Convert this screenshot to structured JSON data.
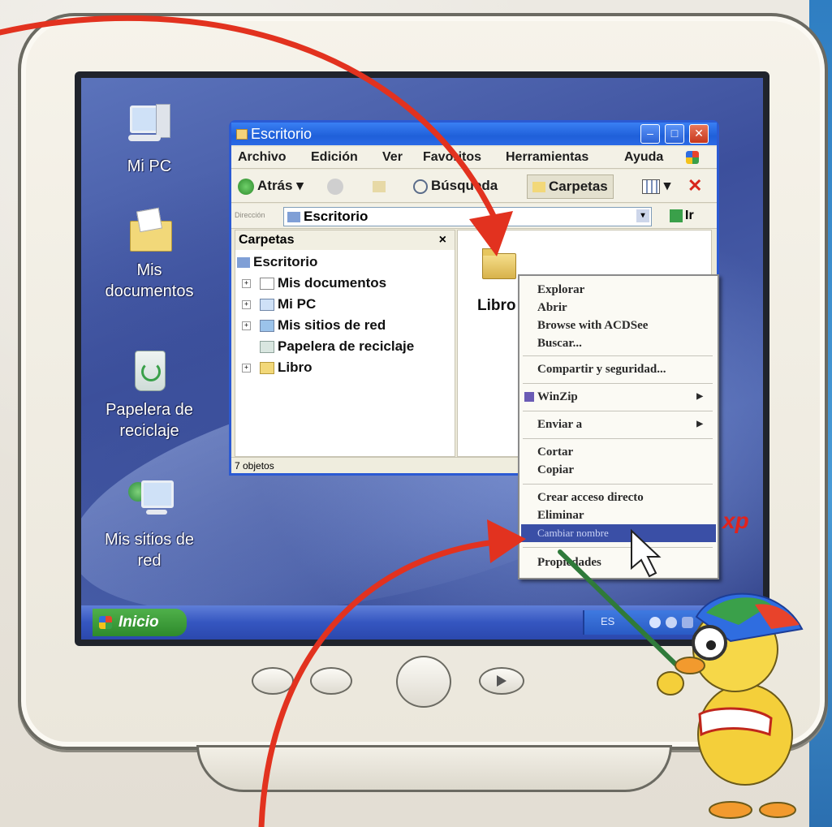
{
  "desktop": {
    "icons": [
      {
        "label": "Mi PC",
        "name": "my-computer-icon"
      },
      {
        "label": "Mis documentos",
        "name": "my-documents-icon"
      },
      {
        "label": "Papelera de reciclaje",
        "name": "recycle-bin-icon"
      },
      {
        "label": "Mis sitios de red",
        "name": "network-places-icon"
      }
    ]
  },
  "taskbar": {
    "start_label": "Inicio",
    "tray_lang": "ES"
  },
  "window": {
    "title": "Escritorio",
    "menu": [
      "Archivo",
      "Edición",
      "Ver",
      "Favoritos",
      "Herramientas",
      "Ayuda"
    ],
    "toolbar": {
      "back_label": "Atrás",
      "search_label": "Búsqueda",
      "folders_label": "Carpetas"
    },
    "address": {
      "label": "Dirección",
      "value": "Escritorio",
      "go_label": "Ir"
    },
    "folders_pane": {
      "title": "Carpetas",
      "items": [
        "Escritorio",
        "Mis documentos",
        "Mi PC",
        "Mis sitios de red",
        "Papelera de reciclaje",
        "Libro"
      ]
    },
    "content": {
      "folder_label": "Libro"
    },
    "status": "7 objetos"
  },
  "context_menu": {
    "items": [
      "Explorar",
      "Abrir",
      "Browse with ACDSee",
      "Buscar...",
      "Compartir y seguridad...",
      "WinZip",
      "Enviar a",
      "Cortar",
      "Copiar",
      "Crear acceso directo",
      "Eliminar",
      "Cambiar nombre",
      "Propiedades"
    ],
    "selected": "Cambiar nombre"
  },
  "branding": {
    "xp_logo": "xp"
  },
  "colors": {
    "arrow": "#e2321f",
    "menu_highlight": "#3a4fa6",
    "titlebar": "#2b6ae6"
  }
}
